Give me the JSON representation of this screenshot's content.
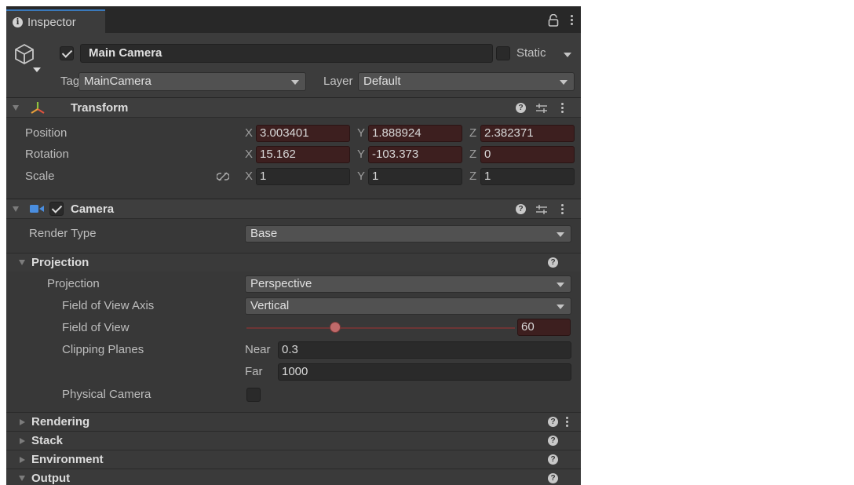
{
  "tab": {
    "title": "Inspector"
  },
  "object": {
    "name": "Main Camera",
    "active": true,
    "static_label": "Static"
  },
  "tag": {
    "label": "Tag",
    "value": "MainCamera"
  },
  "layer": {
    "label": "Layer",
    "value": "Default"
  },
  "transform": {
    "title": "Transform",
    "position": {
      "label": "Position",
      "x": "3.003401",
      "y": "1.888924",
      "z": "2.382371"
    },
    "rotation": {
      "label": "Rotation",
      "x": "15.162",
      "y": "-103.373",
      "z": "0"
    },
    "scale": {
      "label": "Scale",
      "x": "1",
      "y": "1",
      "z": "1"
    },
    "axes": {
      "x": "X",
      "y": "Y",
      "z": "Z"
    }
  },
  "camera": {
    "title": "Camera",
    "enabled": true,
    "render_type": {
      "label": "Render Type",
      "value": "Base"
    },
    "projection_section": {
      "title": "Projection",
      "projection": {
        "label": "Projection",
        "value": "Perspective"
      },
      "fov_axis": {
        "label": "Field of View Axis",
        "value": "Vertical"
      },
      "fov": {
        "label": "Field of View",
        "value": "60",
        "slider_fraction": 0.31
      },
      "clipping": {
        "label": "Clipping Planes",
        "near_label": "Near",
        "near": "0.3",
        "far_label": "Far",
        "far": "1000"
      },
      "physical": {
        "label": "Physical Camera",
        "checked": false
      }
    },
    "sections": [
      "Rendering",
      "Stack",
      "Environment",
      "Output"
    ]
  },
  "colors": {
    "animated_field": "#3d1f1f",
    "accent_tab": "#3a79bb"
  }
}
